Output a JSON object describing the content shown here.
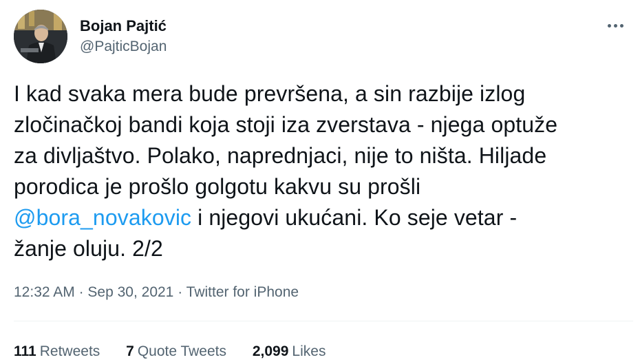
{
  "author": {
    "display_name": "Bojan Pajtić",
    "handle": "@PajticBojan",
    "avatar_icon": "profile-photo"
  },
  "more_icon": "ellipsis-icon",
  "tweet": {
    "line1": "I kad svaka mera bude prevršena, a sin razbije izlog",
    "line2": "zločinačkoj bandi koja stoji iza zverstava - njega optuže",
    "line3": "za divljaštvo. Polako, naprednjaci, nije to ništa. Hiljade",
    "line4": "porodica je prošlo golgotu kakvu su prošli",
    "mention": "@bora_novakovic",
    "line5_rest": " i njegovi ukućani. Ko seje vetar -",
    "line6": "žanje oluju. 2/2"
  },
  "meta": {
    "time": "12:32 AM",
    "sep1": " · ",
    "date": "Sep 30, 2021",
    "sep2": " · ",
    "source": "Twitter for iPhone"
  },
  "stats": {
    "retweets_count": "111",
    "retweets_label": "Retweets",
    "quotes_count": "7",
    "quotes_label": "Quote Tweets",
    "likes_count": "2,099",
    "likes_label": "Likes"
  },
  "colors": {
    "text": "#0f1419",
    "secondary": "#536471",
    "link": "#1d9bf0",
    "divider": "#eff3f4"
  }
}
